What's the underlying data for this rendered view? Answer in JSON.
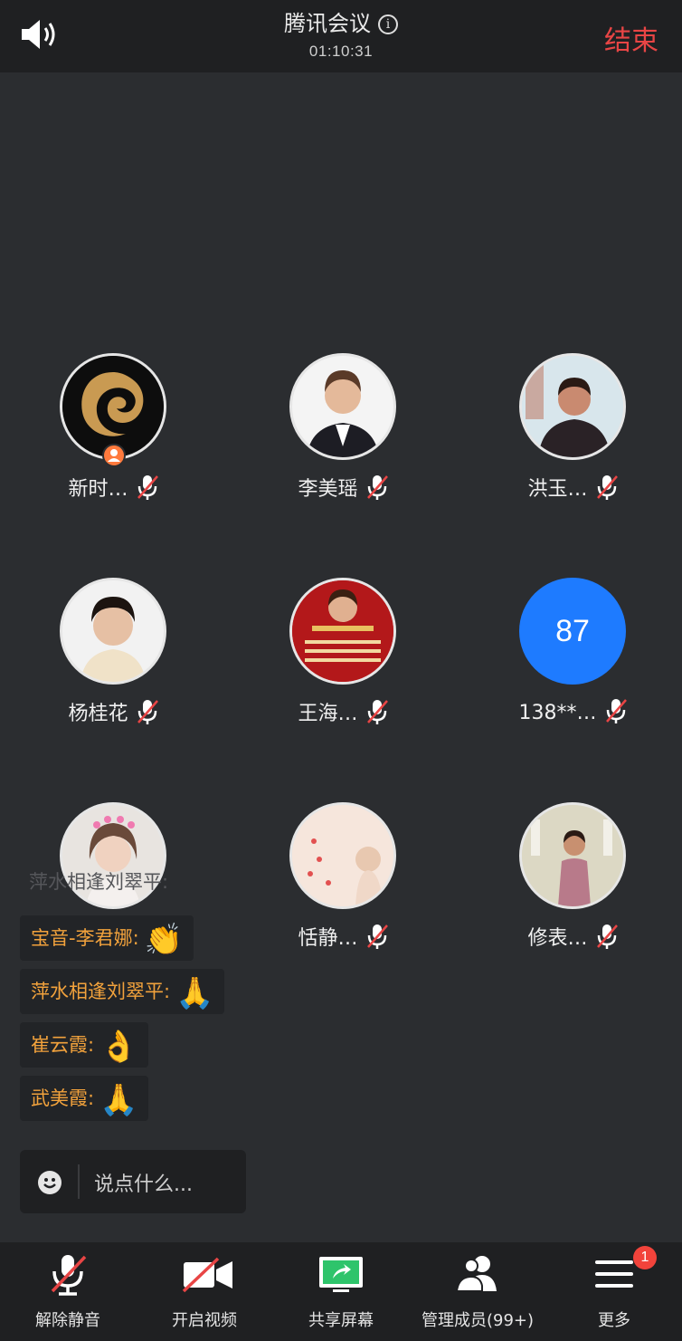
{
  "header": {
    "title": "腾讯会议",
    "timer": "01:10:31",
    "end_label": "结束"
  },
  "participants": [
    {
      "name": "新时…",
      "avatar": "logo-avatar"
    },
    {
      "name": "李美瑶",
      "avatar": "photo"
    },
    {
      "name": "洪玉…",
      "avatar": "photo"
    },
    {
      "name": "杨桂花",
      "avatar": "photo"
    },
    {
      "name": "王海…",
      "avatar": "photo"
    },
    {
      "name": "138**…",
      "avatar_text": "87"
    },
    {
      "name": "",
      "avatar": "photo"
    },
    {
      "name": "恬静…",
      "avatar": "photo"
    },
    {
      "name": "修表…",
      "avatar": "photo"
    }
  ],
  "chat": {
    "ghost": "萍水相逢刘翠平:",
    "messages": [
      {
        "text": "宝音-李君娜:",
        "emoji": "👏"
      },
      {
        "text": "萍水相逢刘翠平:",
        "emoji": "🙏"
      },
      {
        "text": "崔云霞:",
        "emoji": "👌"
      },
      {
        "text": "武美霞:",
        "emoji": "🙏"
      }
    ],
    "input_placeholder": "说点什么..."
  },
  "toolbar": {
    "unmute": "解除静音",
    "video": "开启视频",
    "share": "共享屏幕",
    "members": "管理成员(99+)",
    "more": "更多",
    "more_badge": "1"
  },
  "colors": {
    "accent_end": "#e84545",
    "chat_name": "#f2a23c",
    "share_green": "#2ec46b",
    "number_avatar": "#1e7bff"
  }
}
